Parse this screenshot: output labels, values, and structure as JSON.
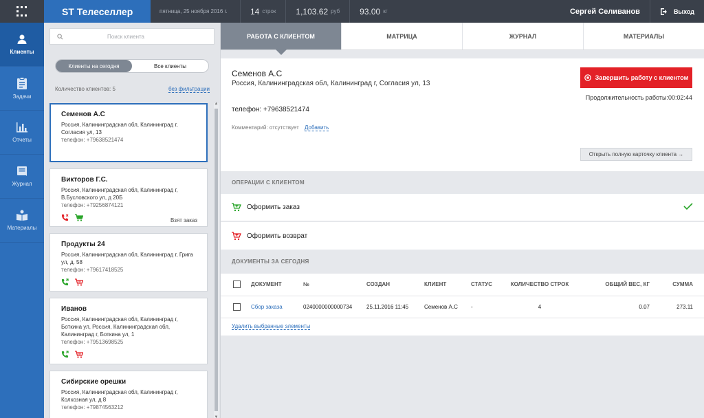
{
  "header": {
    "brand": "ST Телеселлер",
    "date": "пятница, 25 ноября 2016 г.",
    "rows_num": "14",
    "rows_unit": "строк",
    "sum_num": "1,103.62",
    "sum_unit": "руб",
    "weight_num": "93.00",
    "weight_unit": "кг",
    "user": "Сергей Селиванов",
    "logout": "Выход"
  },
  "sidebar": {
    "items": [
      {
        "label": "Клиенты",
        "icon": "user-icon"
      },
      {
        "label": "Задачи",
        "icon": "clipboard-icon"
      },
      {
        "label": "Отчеты",
        "icon": "bar-chart-icon"
      },
      {
        "label": "Журнал",
        "icon": "journal-icon"
      },
      {
        "label": "Материалы",
        "icon": "book-icon"
      }
    ]
  },
  "list": {
    "search_placeholder": "Поиск клиента",
    "toggle_today": "Клиенты на сегодня",
    "toggle_all": "Все клиенты",
    "count_label": "Количество клиентов: 5",
    "no_filter": "без фильтрации",
    "clients": [
      {
        "name": "Семенов А.С",
        "addr": "Россия, Калининградская обл, Калининград г, Согласия ул, 13",
        "phone": "телефон: +79638521474",
        "tag": ""
      },
      {
        "name": "Викторов Г.С.",
        "addr": "Россия, Калининградская обл, Калининград г, В.Бусловского ул, д 20Б",
        "phone": "телефон: +79256874121",
        "tag": "Взят заказ"
      },
      {
        "name": "Продукты 24",
        "addr": "Россия, Калининградская обл, Калининград г, Грига ул, д. 58",
        "phone": "телефон: +79617418525",
        "tag": ""
      },
      {
        "name": "Иванов",
        "addr": "Россия, Калининградская обл, Калининград г, Боткина ул, Россия, Калининградская обл, Калининград г, Боткина ул, 1",
        "phone": "телефон: +79513698525",
        "tag": ""
      },
      {
        "name": "Сибирские орешки",
        "addr": "Россия, Калининградская обл, Калининград г, Колхозная ул, д 8",
        "phone": "телефон: +79874563212",
        "tag": ""
      }
    ]
  },
  "tabs": [
    "РАБОТА С КЛИЕНТОМ",
    "МАТРИЦА",
    "ЖУРНАЛ",
    "МАТЕРИАЛЫ"
  ],
  "client": {
    "name": "Семенов А.С",
    "addr": "Россия, Калининградская обл, Калининград г, Согласия ул, 13",
    "phone": "телефон: +79638521474",
    "comment": "Комментарий: отсутствует",
    "add": "Добавить",
    "finish": "Завершить работу с клиентом",
    "duration": "Продолжительность работы:00:02:44",
    "open_card": "Открыть полную карточку клиента →"
  },
  "operations": {
    "title": "ОПЕРАЦИИ С КЛИЕНТОМ",
    "order": "Оформить заказ",
    "return": "Оформить возврат"
  },
  "documents": {
    "title": "ДОКУМЕНТЫ ЗА СЕГОДНЯ",
    "columns": [
      "ДОКУМЕНТ",
      "№",
      "СОЗДАН",
      "КЛИЕНТ",
      "СТАТУС",
      "КОЛИЧЕСТВО СТРОК",
      "ОБЩИЙ ВЕС, КГ",
      "СУММА"
    ],
    "rows": [
      {
        "doc": "Сбор заказа",
        "num": "0240000000000734",
        "created": "25.11.2016 11:45",
        "client": "Семенов А.С",
        "status": "-",
        "lines": "4",
        "weight": "0.07",
        "sum": "273.11"
      }
    ],
    "remove": "Удалить выбранные элементы"
  },
  "colors": {
    "accent": "#2d6fbb",
    "danger": "#e32127",
    "success": "#2aa52a"
  }
}
